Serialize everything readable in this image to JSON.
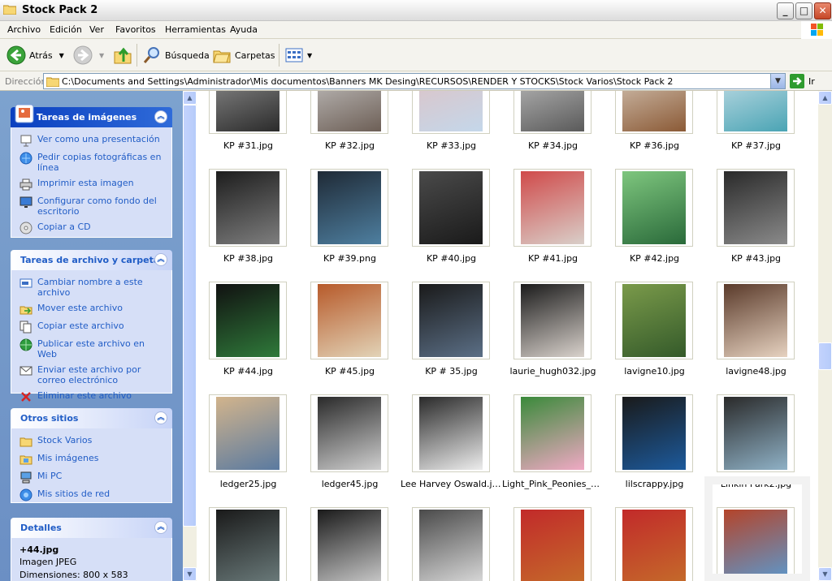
{
  "window": {
    "title": "Stock Pack 2",
    "min": "_",
    "max": "□",
    "close": "✕"
  },
  "menu": [
    "Archivo",
    "Edición",
    "Ver",
    "Favoritos",
    "Herramientas",
    "Ayuda"
  ],
  "toolbar": {
    "back": "Atrás",
    "search": "Búsqueda",
    "folders": "Carpetas"
  },
  "address": {
    "label": "Dirección",
    "path": "C:\\Documents and Settings\\Administrador\\Mis documentos\\Banners MK Desing\\RECURSOS\\RENDER Y STOCKS\\Stock Varios\\Stock Pack 2",
    "go": "Ir"
  },
  "panels": {
    "images": {
      "title": "Tareas de imágenes",
      "items": [
        "Ver como una presentación",
        "Pedir copias fotográficas en línea",
        "Imprimir esta imagen",
        "Configurar como fondo del escritorio",
        "Copiar a CD"
      ]
    },
    "file": {
      "title": "Tareas de archivo y carpeta",
      "items": [
        "Cambiar nombre a este archivo",
        "Mover este archivo",
        "Copiar este archivo",
        "Publicar este archivo en Web",
        "Enviar este archivo por correo electrónico",
        "Eliminar este archivo"
      ]
    },
    "places": {
      "title": "Otros sitios",
      "items": [
        "Stock Varios",
        "Mis imágenes",
        "Mi PC",
        "Mis sitios de red"
      ]
    },
    "details": {
      "title": "Detalles",
      "name": "+44.jpg",
      "type": "Imagen JPEG",
      "dims": "Dimensiones: 800 x 583"
    }
  },
  "files": [
    [
      "KP #31.jpg",
      "KP #32.jpg",
      "KP #33.jpg",
      "KP #34.jpg",
      "KP #36.jpg",
      "KP #37.jpg"
    ],
    [
      "KP #38.jpg",
      "KP #39.png",
      "KP #40.jpg",
      "KP #41.jpg",
      "KP #42.jpg",
      "KP #43.jpg"
    ],
    [
      "KP #44.jpg",
      "KP #45.jpg",
      "KP # 35.jpg",
      "laurie_hugh032.jpg",
      "lavigne10.jpg",
      "lavigne48.jpg"
    ],
    [
      "ledger25.jpg",
      "ledger45.jpg",
      "Lee Harvey Oswald.jpg",
      "Light_Pink_Peonies_Fl...",
      "lilscrappy.jpg",
      "Linkin Park2.jpg"
    ],
    [
      "",
      "",
      "",
      "",
      "",
      ""
    ]
  ]
}
